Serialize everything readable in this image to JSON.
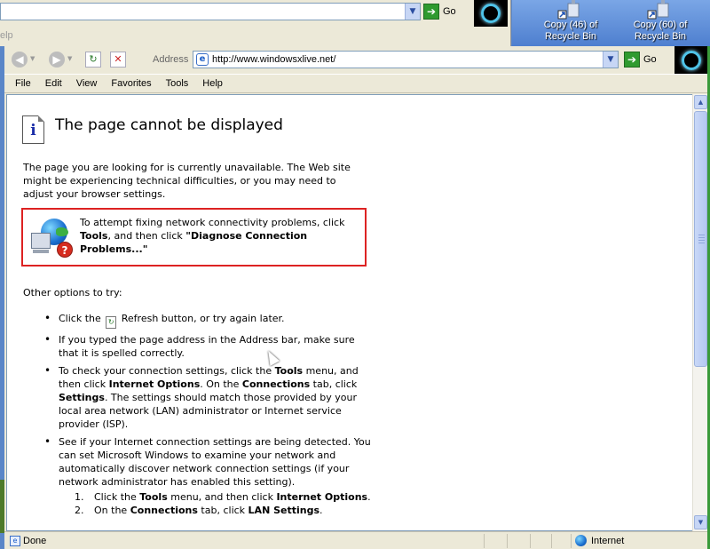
{
  "background_window": {
    "go_label": "Go",
    "help_label": "elp"
  },
  "desktop": {
    "icons": [
      {
        "label_line1": "Copy (46) of",
        "label_line2": "Recycle Bin"
      },
      {
        "label_line1": "Copy (60) of",
        "label_line2": "Recycle Bin"
      }
    ]
  },
  "toolbar": {
    "address_label": "Address",
    "address_value": "http://www.windowsxlive.net/",
    "go_label": "Go"
  },
  "menu": [
    "File",
    "Edit",
    "View",
    "Favorites",
    "Tools",
    "Help"
  ],
  "page": {
    "title": "The page cannot be displayed",
    "intro": "The page you are looking for is currently unavailable. The Web site might be experiencing technical difficulties, or you may need to adjust your browser settings.",
    "diagnose": {
      "text1": "To attempt fixing network connectivity problems, click ",
      "bold1": "Tools",
      "text2": ", and then click ",
      "bold2": "\"Diagnose Connection Problems...\""
    },
    "other_options": "Other options to try:",
    "bullets": {
      "b1_text1": "Click the ",
      "b1_text2": " Refresh button, or try again later.",
      "b2": "If you typed the page address in the Address bar, make sure that it is spelled correctly.",
      "b3_t1": "To check your connection settings, click the ",
      "b3_b1": "Tools",
      "b3_t2": " menu, and then click ",
      "b3_b2": "Internet Options",
      "b3_t3": ". On the ",
      "b3_b3": "Connections",
      "b3_t4": " tab, click ",
      "b3_b4": "Settings",
      "b3_t5": ". The settings should match those provided by your local area network (LAN) administrator or Internet service provider (ISP).",
      "b4": "See if your Internet connection settings are being detected. You can set Microsoft Windows to examine your network and automatically discover network connection settings (if your network administrator has enabled this setting)."
    },
    "steps": [
      {
        "n": "1.",
        "t1": "Click the ",
        "b1": "Tools",
        "t2": " menu, and then click ",
        "b2": "Internet Options",
        "t3": "."
      },
      {
        "n": "2.",
        "t1": "On the ",
        "b1": "Connections",
        "t2": " tab, click ",
        "b2": "LAN Settings",
        "t3": "."
      }
    ]
  },
  "status": {
    "text": "Done",
    "zone": "Internet"
  }
}
